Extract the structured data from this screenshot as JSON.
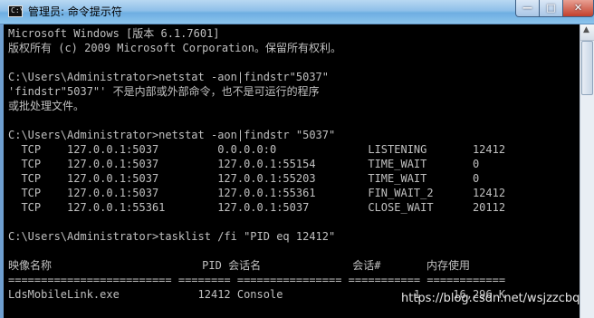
{
  "window": {
    "title": "管理员: 命令提示符",
    "icon_label": "C:\\",
    "min_glyph": "—",
    "max_glyph": "□",
    "close_glyph": "✕"
  },
  "console": {
    "lines": [
      "Microsoft Windows [版本 6.1.7601]",
      "版权所有 (c) 2009 Microsoft Corporation。保留所有权利。",
      "",
      "C:\\Users\\Administrator>netstat -aon|findstr\"5037\"",
      "'findstr\"5037\"' 不是内部或外部命令，也不是可运行的程序",
      "或批处理文件。",
      "",
      "C:\\Users\\Administrator>netstat -aon|findstr \"5037\"",
      "  TCP    127.0.0.1:5037         0.0.0.0:0              LISTENING       12412",
      "  TCP    127.0.0.1:5037         127.0.0.1:55154        TIME_WAIT       0",
      "  TCP    127.0.0.1:5037         127.0.0.1:55203        TIME_WAIT       0",
      "  TCP    127.0.0.1:5037         127.0.0.1:55361        FIN_WAIT_2      12412",
      "  TCP    127.0.0.1:55361        127.0.0.1:5037         CLOSE_WAIT      20112",
      "",
      "C:\\Users\\Administrator>tasklist /fi \"PID eq 12412\"",
      "",
      "映像名称                       PID 会话名              会话#       内存使用",
      "========================= ======== ================ =========== ============",
      "LdsMobileLink.exe            12412 Console                    1     16,296 K"
    ]
  },
  "watermark": "https://blog.csdn.net/wsjzzcbq",
  "colors": {
    "console_bg": "#000000",
    "console_text": "#c0c0c0",
    "close_button": "#c2402c"
  }
}
